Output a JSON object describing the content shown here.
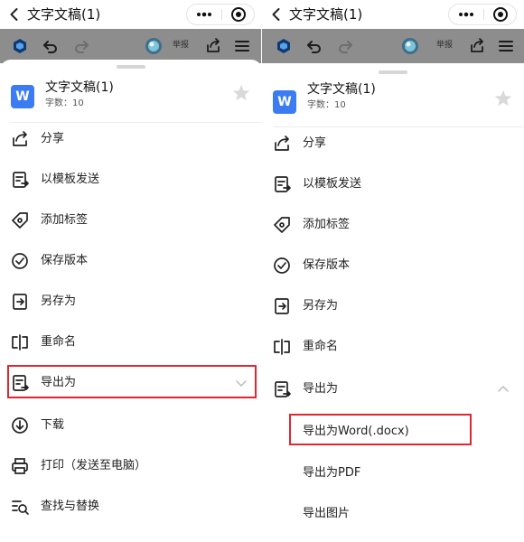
{
  "titlebar": {
    "title": "文字文稿(1)"
  },
  "toolbar": {
    "report_label": "举报"
  },
  "document": {
    "logo_letter": "W",
    "name": "文字文稿(1)",
    "word_count": "字数：10"
  },
  "menu": {
    "items": [
      {
        "label": "分享",
        "icon": "share-icon"
      },
      {
        "label": "以模板发送",
        "icon": "template-send-icon"
      },
      {
        "label": "添加标签",
        "icon": "tag-icon"
      },
      {
        "label": "保存版本",
        "icon": "check-circle-icon"
      },
      {
        "label": "另存为",
        "icon": "save-as-icon"
      },
      {
        "label": "重命名",
        "icon": "rename-icon"
      },
      {
        "label": "导出为",
        "icon": "export-icon"
      },
      {
        "label": "下载",
        "icon": "download-icon"
      },
      {
        "label": "打印（发送至电脑）",
        "icon": "print-icon"
      },
      {
        "label": "查找与替换",
        "icon": "find-replace-icon"
      }
    ],
    "export_submenu": [
      {
        "label": "导出为Word(.docx)"
      },
      {
        "label": "导出为PDF"
      },
      {
        "label": "导出图片"
      }
    ]
  },
  "colors": {
    "highlight": "#e0262f",
    "word_logo": "#3c7cf3",
    "dim_overlay": "#8d8d8d"
  }
}
